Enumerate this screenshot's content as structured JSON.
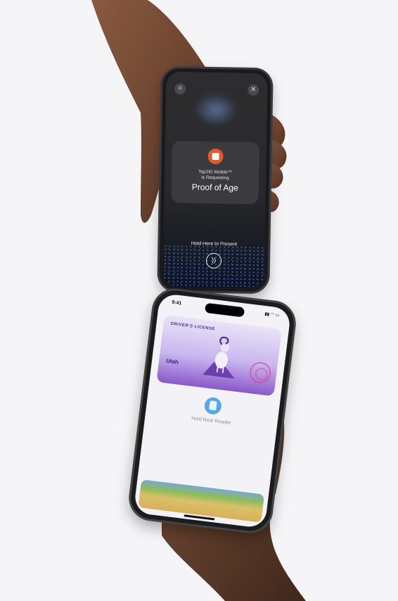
{
  "top_phone": {
    "request_app": "Tap2ID Mobile™",
    "request_sub": "is Requesting",
    "request_title": "Proof of Age",
    "hold_present": "Hold Here to Present"
  },
  "bottom_phone": {
    "status_time": "9:41",
    "license_label": "DRIVER'S LICENSE",
    "license_state": "Utah",
    "hold_reader": "Hold Near Reader"
  },
  "icons": [
    "scan-icon",
    "close-icon",
    "app-badge-icon",
    "nfc-icon",
    "reader-icon"
  ],
  "colors": {
    "background": "#f5f5f7",
    "app_badge": "#e8572b",
    "license_purple": "#8a58c9",
    "reader_blue": "#5aa7e8"
  }
}
